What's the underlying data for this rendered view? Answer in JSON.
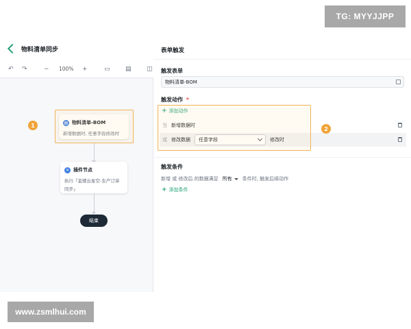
{
  "watermarks": {
    "top": "TG: MYYJJPP",
    "bottom": "www.zsmlhui.com"
  },
  "left_panel": {
    "title": "物料清单同步",
    "toolbar": {
      "zoom": "100%"
    },
    "nodes": [
      {
        "title": "物料清单-BOM",
        "desc": "新增数据时, 任意字段修改时",
        "icon_color": "#3f7fe0"
      },
      {
        "title": "插件节点",
        "desc": "执行「金蝶云星空-生产订单\n同步」",
        "icon_color": "#3f7fe0"
      }
    ],
    "end_label": "结束",
    "badges": [
      "1",
      "2"
    ]
  },
  "right_panel": {
    "heading": "表单触发",
    "trigger_form": {
      "label": "触发表单",
      "value": "物料清单-BOM"
    },
    "trigger_action": {
      "label": "触发动作",
      "required_mark": "*",
      "add_label": "添加动作",
      "rows": [
        {
          "key": "当",
          "text": "新增数据时"
        },
        {
          "key": "或",
          "text": "修改数据",
          "select": "任意字段",
          "suffix": "修改时"
        }
      ]
    },
    "conditions": {
      "label": "触发条件",
      "prefix": "新增 或 修改后 的数据满足",
      "select": "所有",
      "suffix": "条件时, 触发后续动作",
      "add_label": "添加条件"
    }
  },
  "colors": {
    "accent": "#26a17b",
    "highlight": "#f0b35a",
    "badge": "#f0a43a",
    "end_node": "#1e2a36"
  }
}
